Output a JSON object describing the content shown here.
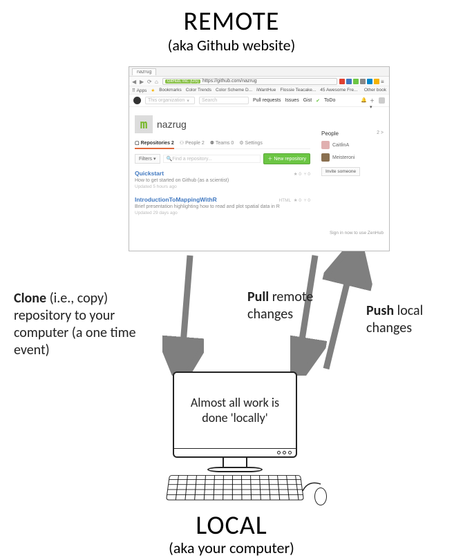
{
  "titles": {
    "remote": "REMOTE",
    "remote_sub": "(aka Github website)",
    "local": "LOCAL",
    "local_sub": "(aka your computer)"
  },
  "labels": {
    "clone_bold": "Clone",
    "clone_rest": " (i.e., copy) repository to your computer (a one time event)",
    "pull_bold": "Pull",
    "pull_rest": " remote changes",
    "push_bold": "Push",
    "push_rest": " local changes",
    "monitor_text": "Almost all work is done 'locally'"
  },
  "browser": {
    "tab_title": "nazrug",
    "url_host": "GitHub, Inc. [US]",
    "url": "https://github.com/nazrug",
    "bookmarks": [
      "Bookmarks",
      "Color Trends",
      "Color Scheme D...",
      "iWantHue",
      "Flossie Teacake...",
      "45 Awesome Fre...",
      "Other book"
    ],
    "org_search_ph": "This organization",
    "org_search2_ph": "Search",
    "nav": [
      "Pull requests",
      "Issues",
      "Gist"
    ],
    "todo": "ToDo",
    "org_name": "nazrug",
    "tabs": [
      {
        "label": "Repositories",
        "count": "2"
      },
      {
        "label": "People",
        "count": "2"
      },
      {
        "label": "Teams",
        "count": "0"
      },
      {
        "label": "Settings",
        "count": ""
      }
    ],
    "filters_label": "Filters",
    "find_repo_ph": "Find a repository...",
    "new_repo": "New repository",
    "repos": [
      {
        "name": "Quickstart",
        "desc": "How to get started on Github (as a scientist)",
        "updated": "Updated 5 hours ago",
        "lang": "",
        "stars": "0",
        "forks": "0"
      },
      {
        "name": "IntroductionToMappingWithR",
        "desc": "Brief presentation highlighting how to read and plot spatial data in R",
        "updated": "Updated 29 days ago",
        "lang": "HTML",
        "stars": "0",
        "forks": "0"
      }
    ],
    "people_header": "People",
    "people_count": "2 >",
    "people": [
      "CaitlinA",
      "Meisteroni"
    ],
    "invite": "Invite someone",
    "zenhub": "Sign in now to use ZenHub"
  }
}
